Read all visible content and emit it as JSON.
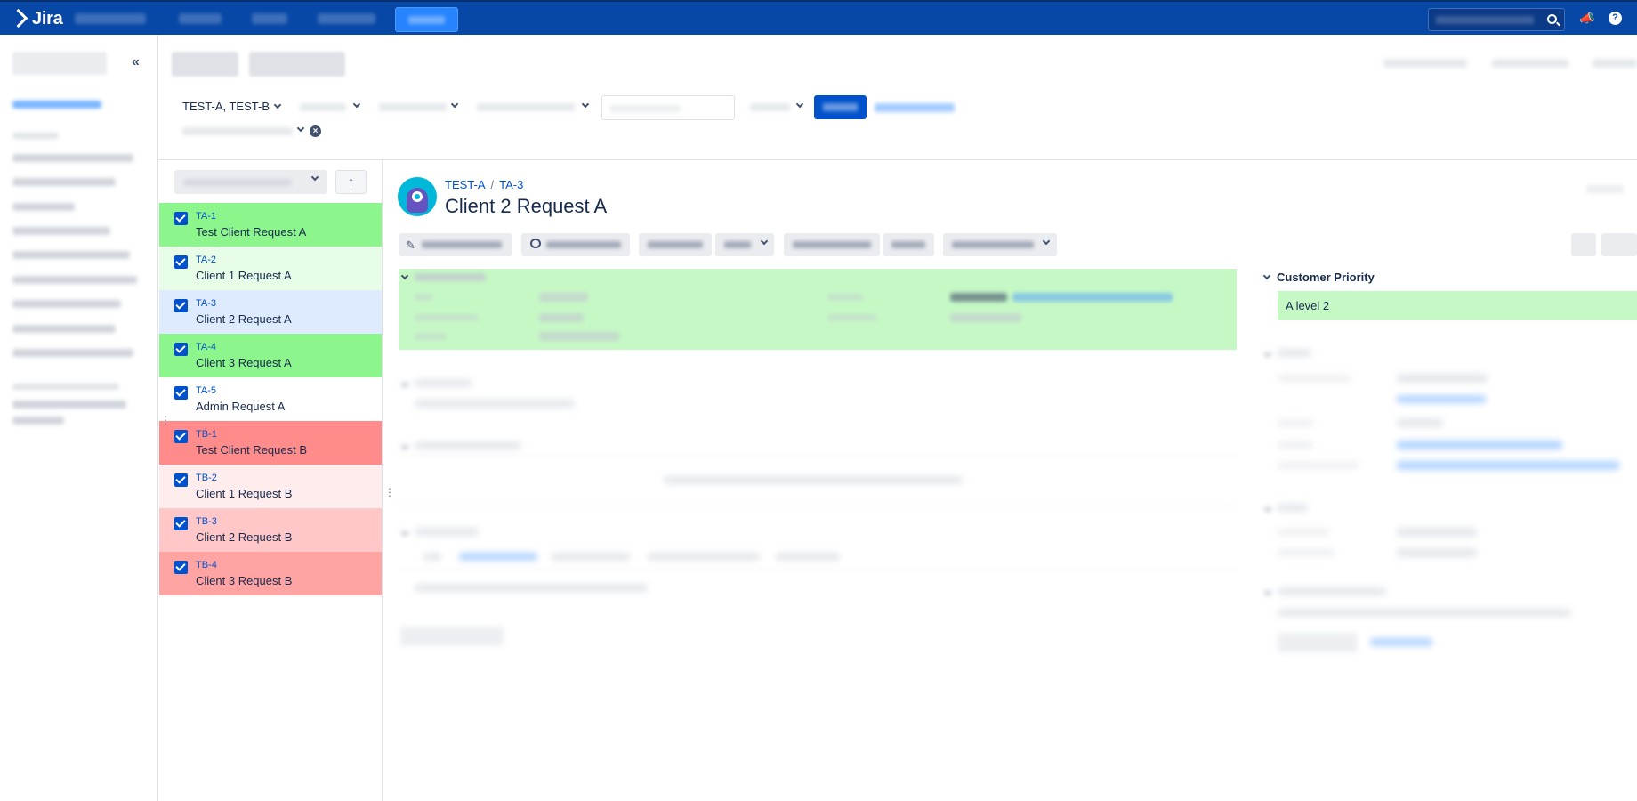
{
  "app": {
    "logo_text": "Jira"
  },
  "filters": {
    "project_value": "TEST-A, TEST-B"
  },
  "issues": [
    {
      "key": "TA-1",
      "summary": "Test Client Request A",
      "bg": "#8cf58c"
    },
    {
      "key": "TA-2",
      "summary": "Client 1 Request A",
      "bg": "#e8fde8"
    },
    {
      "key": "TA-3",
      "summary": "Client 2 Request A",
      "bg": "#deebff"
    },
    {
      "key": "TA-4",
      "summary": "Client 3 Request A",
      "bg": "#8cf58c"
    },
    {
      "key": "TA-5",
      "summary": "Admin Request A",
      "bg": "#ffffff"
    },
    {
      "key": "TB-1",
      "summary": "Test Client Request B",
      "bg": "#ff8b8b"
    },
    {
      "key": "TB-2",
      "summary": "Client 1 Request B",
      "bg": "#ffecec"
    },
    {
      "key": "TB-3",
      "summary": "Client 2 Request B",
      "bg": "#ffc7c7"
    },
    {
      "key": "TB-4",
      "summary": "Client 3 Request B",
      "bg": "#ffa3a3"
    }
  ],
  "detail": {
    "project": "TEST-A",
    "key": "TA-3",
    "title": "Client 2 Request A"
  },
  "customer_priority": {
    "label": "Customer Priority",
    "value": "A level 2"
  },
  "colors": {
    "nav": "#0747a6",
    "link": "#0052cc",
    "highlight_green": "#c6f8c6"
  },
  "icons": [
    "search-icon",
    "megaphone-icon",
    "help-icon",
    "collapse-icon",
    "arrow-up-icon",
    "edit-icon",
    "comment-icon",
    "clear-icon",
    "checkbox-icon",
    "chevron-down-icon"
  ]
}
